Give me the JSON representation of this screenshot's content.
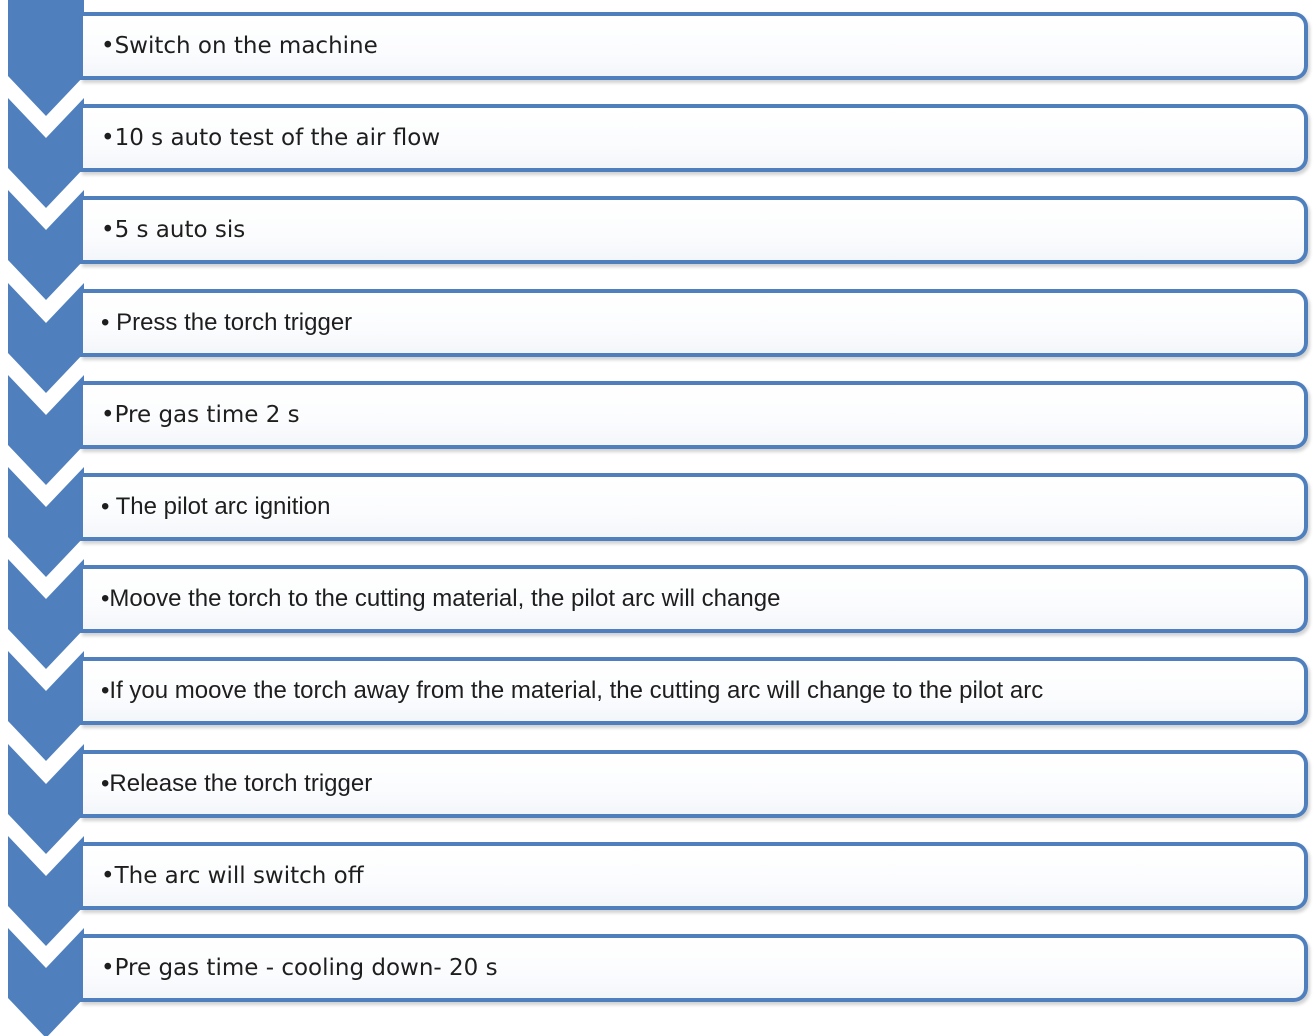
{
  "accent_color": "#4f80bd",
  "steps": [
    {
      "text": "•Switch on the machine",
      "font": "dejavu"
    },
    {
      "text": "•10 s auto test of the air flow",
      "font": "dejavu"
    },
    {
      "text": "•5 s auto sis",
      "font": "dejavu"
    },
    {
      "text": "• Press the torch trigger",
      "font": "sans"
    },
    {
      "text": "•Pre gas time 2 s",
      "font": "dejavu"
    },
    {
      "text": "• The pilot arc ignition",
      "font": "sans"
    },
    {
      "text": "•Moove the torch to the cutting material, the pilot arc will change",
      "font": "sans"
    },
    {
      "text": "•If you moove the torch away from the material, the cutting arc will change to the pilot arc",
      "font": "sans"
    },
    {
      "text": "•Release the torch trigger",
      "font": "sans"
    },
    {
      "text": "•The arc will switch off",
      "font": "dejavu"
    },
    {
      "text": "•Pre gas time - cooling down- 20 s",
      "font": "dejavu"
    }
  ]
}
